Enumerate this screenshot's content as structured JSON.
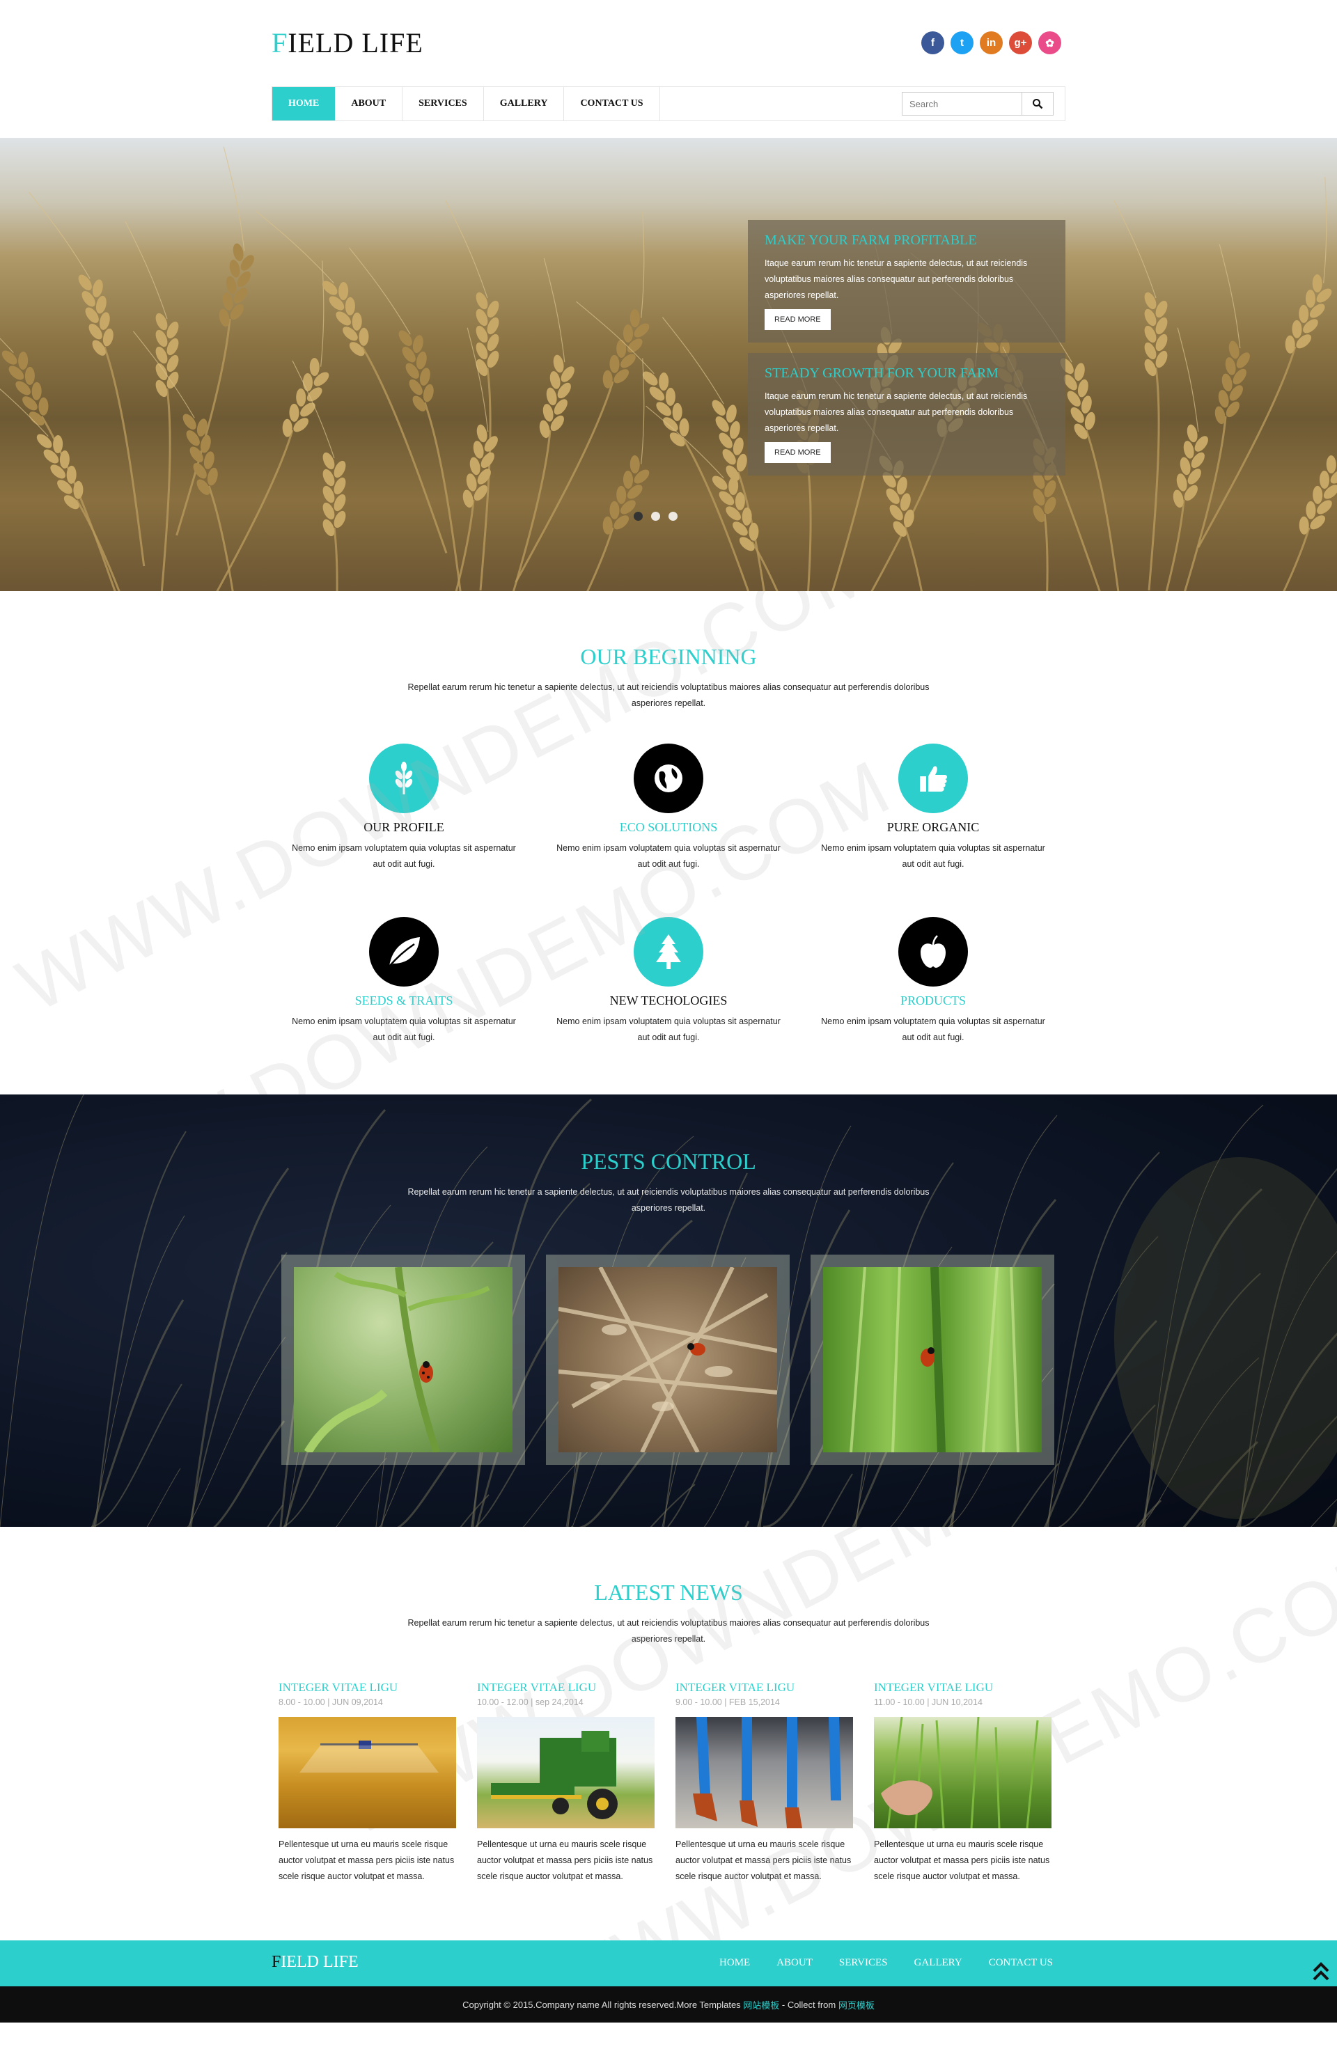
{
  "header": {
    "logo_first": "F",
    "logo_rest": "IELD LIFE",
    "social": [
      {
        "name": "facebook-icon",
        "glyph": "f",
        "color": "#3b5998"
      },
      {
        "name": "twitter-icon",
        "glyph": "t",
        "color": "#1da1f2"
      },
      {
        "name": "linkedin-icon",
        "glyph": "in",
        "color": "#e07b22"
      },
      {
        "name": "google-plus-icon",
        "glyph": "g+",
        "color": "#dd4b39"
      },
      {
        "name": "dribbble-icon",
        "glyph": "✿",
        "color": "#ea4c89"
      }
    ]
  },
  "nav": {
    "items": [
      "HOME",
      "ABOUT",
      "SERVICES",
      "GALLERY",
      "CONTACT US"
    ],
    "search_placeholder": "Search"
  },
  "hero": {
    "slides": [
      {
        "title": "MAKE YOUR FARM PROFITABLE",
        "text": "Itaque earum rerum hic tenetur a sapiente delectus, ut aut reiciendis voluptatibus maiores alias consequatur aut perferendis doloribus asperiores repellat.",
        "button": "READ MORE"
      },
      {
        "title": "STEADY GROWTH FOR YOUR FARM",
        "text": "Itaque earum rerum hic tenetur a sapiente delectus, ut aut reiciendis voluptatibus maiores alias consequatur aut perferendis doloribus asperiores repellat.",
        "button": "READ MORE"
      }
    ],
    "active_dot": 0
  },
  "beginning": {
    "title": "OUR BEGINNING",
    "desc": "Repellat earum rerum hic tenetur a sapiente delectus, ut aut reiciendis voluptatibus maiores alias consequatur aut perferendis doloribus asperiores repellat.",
    "features": [
      {
        "title": "OUR PROFILE",
        "text": "Nemo enim ipsam voluptatem quia voluptas sit aspernatur aut odit aut fugi.",
        "icon": "wheat-icon",
        "style": "teal",
        "title_color": "dark"
      },
      {
        "title": "ECO SOLUTIONS",
        "text": "Nemo enim ipsam voluptatem quia voluptas sit aspernatur aut odit aut fugi.",
        "icon": "globe-icon",
        "style": "dark",
        "title_color": "teal"
      },
      {
        "title": "PURE ORGANIC",
        "text": "Nemo enim ipsam voluptatem quia voluptas sit aspernatur aut odit aut fugi.",
        "icon": "thumbs-up-icon",
        "style": "teal",
        "title_color": "dark"
      },
      {
        "title": "SEEDS & TRAITS",
        "text": "Nemo enim ipsam voluptatem quia voluptas sit aspernatur aut odit aut fugi.",
        "icon": "leaf-icon",
        "style": "dark",
        "title_color": "teal"
      },
      {
        "title": "NEW TECHOLOGIES",
        "text": "Nemo enim ipsam voluptatem quia voluptas sit aspernatur aut odit aut fugi.",
        "icon": "tree-icon",
        "style": "teal",
        "title_color": "dark"
      },
      {
        "title": "PRODUCTS",
        "text": "Nemo enim ipsam voluptatem quia voluptas sit aspernatur aut odit aut fugi.",
        "icon": "apple-icon",
        "style": "dark",
        "title_color": "teal"
      }
    ]
  },
  "pests": {
    "title": "PESTS CONTROL",
    "desc": "Repellat earum rerum hic tenetur a sapiente delectus, ut aut reiciendis voluptatibus maiores alias consequatur aut perferendis doloribus asperiores repellat."
  },
  "news": {
    "title": "LATEST NEWS",
    "desc": "Repellat earum rerum hic tenetur a sapiente delectus, ut aut reiciendis voluptatibus maiores alias consequatur aut perferendis doloribus asperiores repellat.",
    "items": [
      {
        "title": "INTEGER VITAE LIGU",
        "date": "8.00 - 10.00 | JUN 09,2014",
        "text": "Pellentesque ut urna eu mauris scele risque auctor volutpat et massa pers piciis iste natus scele risque auctor volutpat et massa."
      },
      {
        "title": "INTEGER VITAE LIGU",
        "date": "10.00 - 12.00 | sep 24,2014",
        "text": "Pellentesque ut urna eu mauris scele risque auctor volutpat et massa pers piciis iste natus scele risque auctor volutpat et massa."
      },
      {
        "title": "INTEGER VITAE LIGU",
        "date": "9.00 - 10.00 | FEB 15,2014",
        "text": "Pellentesque ut urna eu mauris scele risque auctor volutpat et massa pers piciis iste natus scele risque auctor volutpat et massa."
      },
      {
        "title": "INTEGER VITAE LIGU",
        "date": "11.00 - 10.00 | JUN 10,2014",
        "text": "Pellentesque ut urna eu mauris scele risque auctor volutpat et massa pers piciis iste natus scele risque auctor volutpat et massa."
      }
    ]
  },
  "footer": {
    "logo_first": "F",
    "logo_rest": "IELD LIFE",
    "nav": [
      "HOME",
      "ABOUT",
      "SERVICES",
      "GALLERY",
      "CONTACT US"
    ],
    "copyright_prefix": "Copyright © 2015.Company name All rights reserved.More Templates ",
    "link1": "网站模板",
    "copyright_mid": " - Collect from ",
    "link2": "网页模板"
  },
  "watermark": "WWW.DOWNDEMO.COM",
  "colors": {
    "accent": "#2ccfcc",
    "dark": "#000000",
    "footer_bar": "#0e0e0e"
  }
}
